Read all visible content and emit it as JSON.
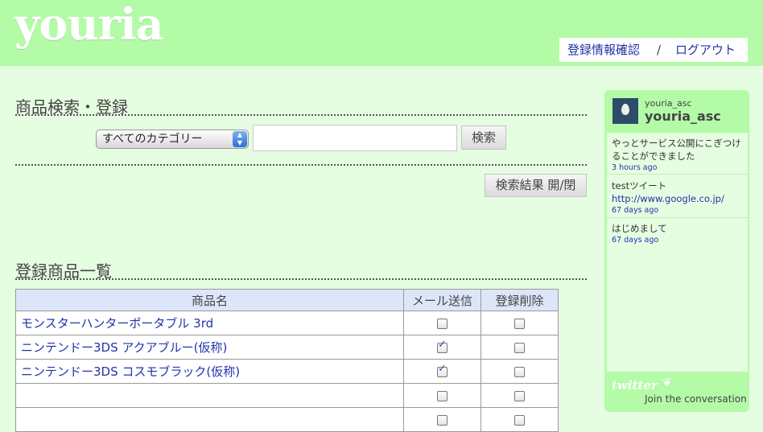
{
  "header": {
    "logo": "youria",
    "nav": {
      "profile_link": "登録情報確認",
      "separator": "/",
      "logout_link": "ログアウト"
    }
  },
  "search_section": {
    "title": "商品検索・登録",
    "category_select_value": "すべてのカテゴリー",
    "search_button": "検索",
    "toggle_results_button": "検索結果 開/閉"
  },
  "items_section": {
    "title": "登録商品一覧",
    "columns": [
      "商品名",
      "メール送信",
      "登録削除"
    ],
    "rows": [
      {
        "name": "モンスターハンターポータブル 3rd",
        "mail": false,
        "delete": false
      },
      {
        "name": "ニンテンドー3DS アクアブルー(仮称)",
        "mail": true,
        "delete": false
      },
      {
        "name": "ニンテンドー3DS コスモブラック(仮称)",
        "mail": true,
        "delete": false
      },
      {
        "name": "",
        "mail": false,
        "delete": false
      },
      {
        "name": "",
        "mail": false,
        "delete": false
      }
    ]
  },
  "twitter_widget": {
    "screen_name_small": "youria_asc",
    "screen_name": "youria_asc",
    "tweets": [
      {
        "text": "やっとサービス公開にこぎつけることができました",
        "link": "",
        "time": "3 hours ago"
      },
      {
        "text": "testツイート ",
        "link": "http://www.google.co.jp/",
        "time": "67 days ago"
      },
      {
        "text": "はじめまして",
        "link": "",
        "time": "67 days ago"
      }
    ],
    "logo": "twitter",
    "join_text": "Join the conversation"
  },
  "colors": {
    "header_bg": "#b4fba8",
    "page_bg": "#e5fde1",
    "link": "#2233aa",
    "table_header_bg": "#dde6f9"
  }
}
